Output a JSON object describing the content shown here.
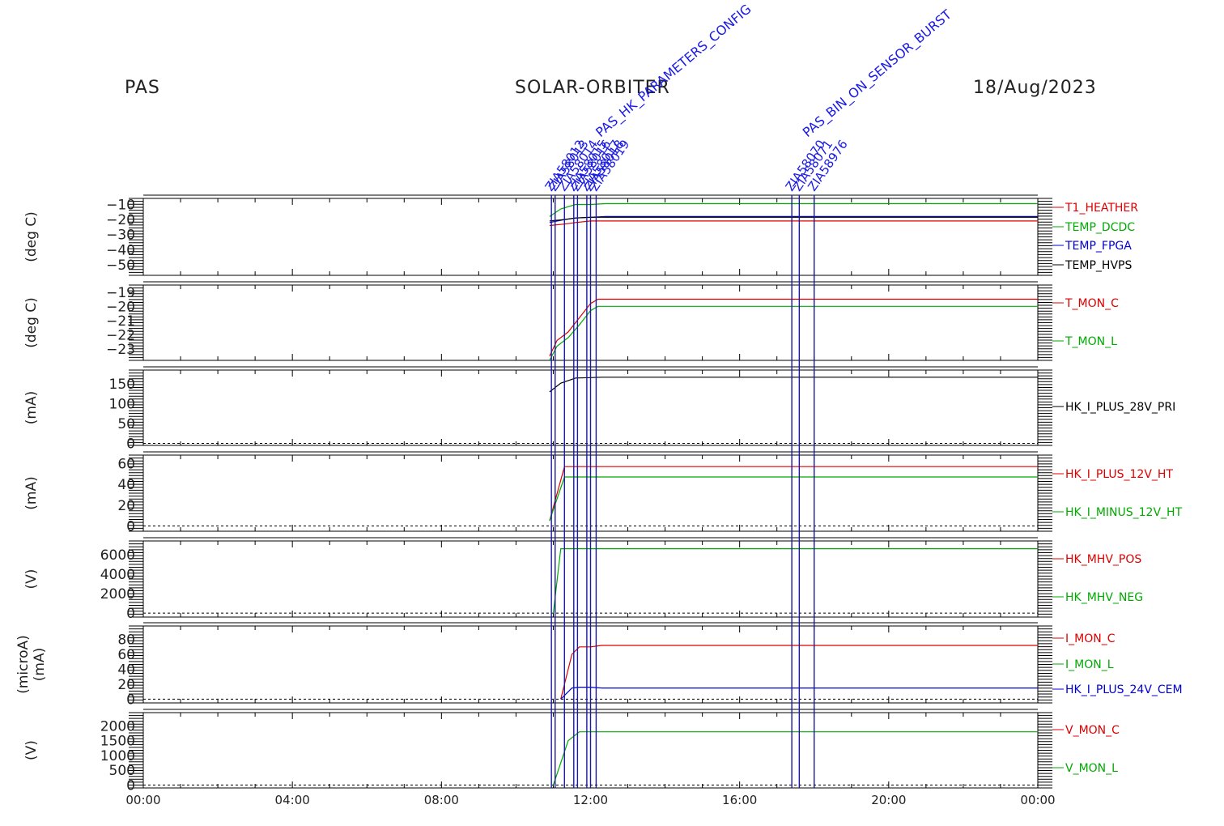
{
  "header": {
    "instrument": "PAS",
    "mission": "SOLAR-ORBITER",
    "date": "18/Aug/2023"
  },
  "colors": {
    "red": "#dd0000",
    "green": "#00aa00",
    "blue": "#0000cc",
    "black": "#000000",
    "event_line": "#1a1aa0",
    "event_label": "#1a1ae6"
  },
  "chart_data": [
    {
      "type": "line",
      "ylabel": "(deg C)",
      "ylim": [
        -57,
        -6
      ],
      "yticks": [
        -10,
        -20,
        -30,
        -40,
        -50
      ],
      "series": [
        {
          "name": "T1_HEATHER",
          "color": "#dd0000",
          "values": [
            [
              10.9,
              -24
            ],
            [
              11.3,
              -23
            ],
            [
              11.6,
              -22
            ],
            [
              12.0,
              -21
            ],
            [
              12.4,
              -21
            ],
            [
              14,
              -21
            ],
            [
              16,
              -21
            ],
            [
              18,
              -21
            ],
            [
              20,
              -21
            ],
            [
              22,
              -21
            ],
            [
              24,
              -21
            ]
          ]
        },
        {
          "name": "TEMP_DCDC",
          "color": "#00aa00",
          "values": [
            [
              10.9,
              -18
            ],
            [
              11.2,
              -13
            ],
            [
              11.6,
              -10
            ],
            [
              12.0,
              -10
            ],
            [
              12.4,
              -9.5
            ],
            [
              14,
              -9.5
            ],
            [
              16,
              -9.5
            ],
            [
              18,
              -9.5
            ],
            [
              20,
              -9.5
            ],
            [
              22,
              -9.5
            ],
            [
              24,
              -9.5
            ]
          ]
        },
        {
          "name": "TEMP_FPGA",
          "color": "#0000cc",
          "values": [
            [
              10.9,
              -22
            ],
            [
              11.3,
              -20
            ],
            [
              11.6,
              -19
            ],
            [
              12.0,
              -18.5
            ],
            [
              12.4,
              -18
            ],
            [
              14,
              -18
            ],
            [
              16,
              -18
            ],
            [
              18,
              -18
            ],
            [
              20,
              -18
            ],
            [
              22,
              -18
            ],
            [
              24,
              -18
            ]
          ]
        },
        {
          "name": "TEMP_HVPS",
          "color": "#000000",
          "values": [
            [
              10.9,
              -21
            ],
            [
              11.3,
              -20
            ],
            [
              11.6,
              -19
            ],
            [
              12.0,
              -18.5
            ],
            [
              12.4,
              -18.5
            ],
            [
              14,
              -18.5
            ],
            [
              16,
              -18.5
            ],
            [
              18,
              -18.5
            ],
            [
              20,
              -18.5
            ],
            [
              22,
              -18.5
            ],
            [
              24,
              -18.5
            ]
          ]
        }
      ]
    },
    {
      "type": "line",
      "ylabel": "(deg C)",
      "ylim": [
        -23.8,
        -18.5
      ],
      "yticks": [
        -19,
        -20,
        -21,
        -22,
        -23
      ],
      "series": [
        {
          "name": "T_MON_C",
          "color": "#dd0000",
          "values": [
            [
              10.9,
              -23.5
            ],
            [
              11.1,
              -22.4
            ],
            [
              11.4,
              -21.8
            ],
            [
              11.7,
              -20.8
            ],
            [
              12.0,
              -19.8
            ],
            [
              12.2,
              -19.5
            ],
            [
              13,
              -19.5
            ],
            [
              14,
              -19.5
            ],
            [
              15,
              -19.5
            ],
            [
              16,
              -19.5
            ],
            [
              17,
              -19.5
            ],
            [
              18,
              -19.5
            ],
            [
              19,
              -19.5
            ],
            [
              20,
              -19.5
            ],
            [
              21,
              -19.5
            ],
            [
              22,
              -19.5
            ],
            [
              23,
              -19.5
            ],
            [
              24,
              -19.5
            ]
          ]
        },
        {
          "name": "T_MON_L",
          "color": "#00aa00",
          "values": [
            [
              10.9,
              -23.8
            ],
            [
              11.1,
              -22.8
            ],
            [
              11.4,
              -22.2
            ],
            [
              11.7,
              -21.3
            ],
            [
              12.0,
              -20.3
            ],
            [
              12.2,
              -20.0
            ],
            [
              13,
              -20.0
            ],
            [
              14,
              -20.0
            ],
            [
              15,
              -20.0
            ],
            [
              16,
              -20.0
            ],
            [
              17,
              -20.0
            ],
            [
              18,
              -20.0
            ],
            [
              19,
              -20.0
            ],
            [
              20,
              -20.0
            ],
            [
              21,
              -20.0
            ],
            [
              22,
              -20.0
            ],
            [
              23,
              -20.0
            ],
            [
              24,
              -20.0
            ]
          ]
        }
      ]
    },
    {
      "type": "line",
      "ylabel": "(mA)",
      "ylim": [
        -5,
        185
      ],
      "yticks": [
        150,
        100,
        50,
        0
      ],
      "series": [
        {
          "name": "HK_I_PLUS_28V_PRI",
          "color": "#000000",
          "values": [
            [
              10.9,
              130
            ],
            [
              11.2,
              152
            ],
            [
              11.6,
              165
            ],
            [
              12.0,
              166
            ],
            [
              12.3,
              167
            ],
            [
              24,
              167
            ]
          ]
        }
      ]
    },
    {
      "type": "line",
      "ylabel": "(mA)",
      "ylim": [
        -5,
        68
      ],
      "yticks": [
        60,
        40,
        20,
        0
      ],
      "series": [
        {
          "name": "HK_I_PLUS_12V_HT",
          "color": "#dd0000",
          "values": [
            [
              10.9,
              5
            ],
            [
              11.3,
              57
            ],
            [
              11.6,
              57
            ],
            [
              12.0,
              57
            ],
            [
              12.3,
              57
            ],
            [
              24,
              57
            ]
          ]
        },
        {
          "name": "HK_I_MINUS_12V_HT",
          "color": "#00aa00",
          "values": [
            [
              10.9,
              5
            ],
            [
              11.3,
              47
            ],
            [
              11.6,
              47
            ],
            [
              12.0,
              47
            ],
            [
              12.3,
              47
            ],
            [
              24,
              47
            ]
          ]
        }
      ]
    },
    {
      "type": "line",
      "ylabel": "(V)",
      "ylim": [
        -400,
        7400
      ],
      "yticks": [
        6000,
        4000,
        2000,
        0
      ],
      "series": [
        {
          "name": "HK_MHV_POS",
          "color": "#dd0000",
          "values": []
        },
        {
          "name": "HK_MHV_NEG",
          "color": "#00aa00",
          "values": [
            [
              11.0,
              0
            ],
            [
              11.2,
              6600
            ],
            [
              11.6,
              6600
            ],
            [
              12.0,
              6600
            ],
            [
              12.3,
              6600
            ],
            [
              24,
              6600
            ]
          ]
        }
      ]
    },
    {
      "type": "line",
      "ylabel": "(microA)\n(mA)",
      "ylim": [
        -5,
        98
      ],
      "yticks": [
        80,
        60,
        40,
        20,
        0
      ],
      "series": [
        {
          "name": "I_MON_C",
          "color": "#dd0000",
          "values": [
            [
              11.2,
              0
            ],
            [
              11.5,
              60
            ],
            [
              11.7,
              70
            ],
            [
              12.0,
              70
            ],
            [
              12.3,
              72
            ],
            [
              24,
              72
            ]
          ]
        },
        {
          "name": "I_MON_L",
          "color": "#00aa00",
          "values": []
        },
        {
          "name": "HK_I_PLUS_24V_CEM",
          "color": "#0000cc",
          "values": [
            [
              11.2,
              0
            ],
            [
              11.5,
              15
            ],
            [
              11.7,
              16
            ],
            [
              12.0,
              16
            ],
            [
              12.3,
              15
            ],
            [
              24,
              15
            ]
          ]
        }
      ]
    },
    {
      "type": "line",
      "ylabel": "(V)",
      "ylim": [
        -100,
        2450
      ],
      "yticks": [
        2000,
        1500,
        1000,
        500,
        0
      ],
      "series": [
        {
          "name": "V_MON_C",
          "color": "#dd0000",
          "values": []
        },
        {
          "name": "V_MON_L",
          "color": "#00aa00",
          "values": [
            [
              11.0,
              0
            ],
            [
              11.4,
              1500
            ],
            [
              11.7,
              1800
            ],
            [
              12.0,
              1800
            ],
            [
              12.3,
              1800
            ],
            [
              24,
              1800
            ]
          ]
        }
      ]
    }
  ],
  "xaxis": {
    "range": [
      0,
      24
    ],
    "ticks": [
      0,
      4,
      8,
      12,
      16,
      20,
      24
    ],
    "tick_labels": [
      "00:00",
      "04:00",
      "08:00",
      "12:00",
      "16:00",
      "20:00",
      "00:00"
    ]
  },
  "events": [
    {
      "time": 10.95,
      "label": "ZIA58012"
    },
    {
      "time": 11.05,
      "label": "ZIA58013"
    },
    {
      "time": 11.3,
      "label": "ZIA58014"
    },
    {
      "time": 11.55,
      "label": "ZIA58015"
    },
    {
      "time": 11.65,
      "label": "ZIA58016"
    },
    {
      "time": 11.9,
      "label": "ZIA58017"
    },
    {
      "time": 12.0,
      "label": "ZIA58018"
    },
    {
      "time": 12.15,
      "label": "ZIA58019"
    },
    {
      "time": 17.4,
      "label": "ZIA58070"
    },
    {
      "time": 17.6,
      "label": "ZIA58071"
    },
    {
      "time": 18.0,
      "label": "ZIA58976"
    }
  ],
  "event_groups": [
    {
      "time": 12.05,
      "text": "PAS_HK_PARAMETERS_CONFIG"
    },
    {
      "time": 17.6,
      "text": "PAS_BIN_ON_SENSOR_BURST"
    }
  ]
}
